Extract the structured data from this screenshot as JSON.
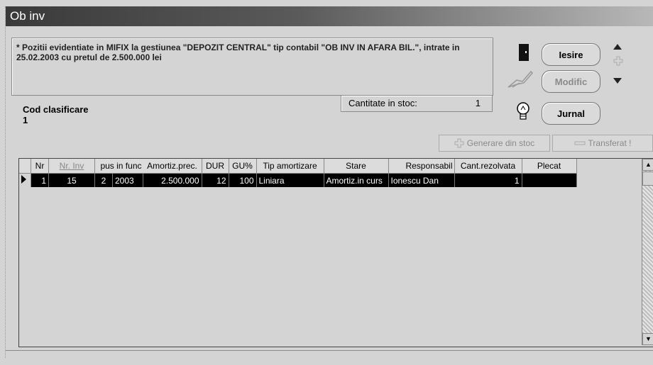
{
  "window": {
    "title": "Ob inv"
  },
  "message": "* Pozitii evidentiate in MIFIX la gestiunea \"DEPOZIT CENTRAL\" tip contabil \"OB INV IN AFARA BIL.\", intrate in 25.02.2003 cu pretul de 2.500.000 lei",
  "stock": {
    "label": "Cantitate in stoc:",
    "value": "1"
  },
  "classification": {
    "label": "Cod clasificare",
    "value": "1"
  },
  "buttons": {
    "exit": "Iesire",
    "modify": "Modific",
    "journal": "Jurnal",
    "generate": "Generare din stoc",
    "transfer": "Transferat !"
  },
  "icons": {
    "exit": "door-icon",
    "modify": "hand-pen-icon",
    "journal": "lightbulb-icon",
    "up": "arrow-up-icon",
    "down": "arrow-down-icon",
    "plus": "plus-icon",
    "generate": "plus-icon",
    "transfer": "minus-icon"
  },
  "table": {
    "headers": [
      "Nr",
      "Nr. Inv",
      "pus in func",
      "",
      "Amortiz.prec.",
      "DUR",
      "GU%",
      "Tip amortizare",
      "Stare",
      "Responsabil",
      "Cant.rezolvata",
      "Plecat"
    ],
    "rows": [
      [
        "1",
        "15",
        "2",
        "2003",
        "2.500.000",
        "12",
        "100",
        "Liniara",
        "Amortiz.in curs",
        "Ionescu Dan",
        "1",
        ""
      ]
    ]
  }
}
